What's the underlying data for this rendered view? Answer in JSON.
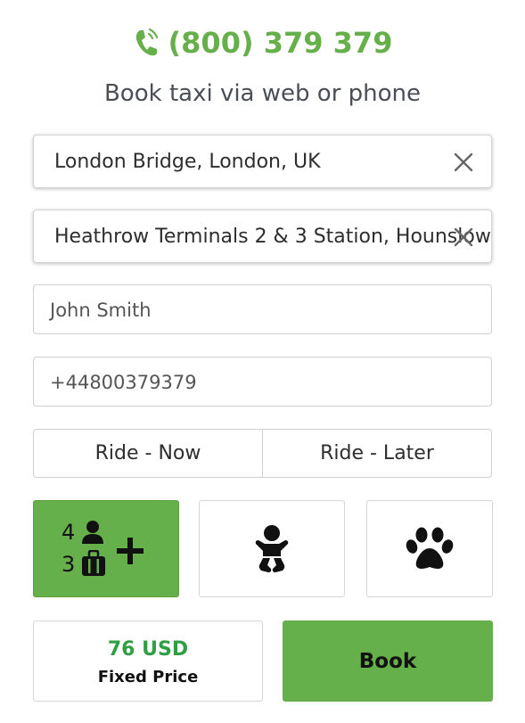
{
  "header": {
    "phone": "(800) 379 379",
    "subtitle": "Book taxi via web or phone",
    "accent_color": "#66b04b"
  },
  "form": {
    "pickup": {
      "value": "London Bridge, London, UK",
      "clear_icon": "close-icon"
    },
    "dropoff": {
      "value": "Heathrow Terminals 2 & 3 Station, Hounslow",
      "clear_icon": "close-icon"
    },
    "name": {
      "value": "John Smith"
    },
    "phone": {
      "value": "+44800379379"
    }
  },
  "ride_options": {
    "now": "Ride - Now",
    "later": "Ride - Later"
  },
  "extras": {
    "passengers": "4",
    "luggage": "3",
    "passenger_icon": "person-icon",
    "luggage_icon": "suitcase-icon",
    "add_icon": "plus-icon",
    "child_seat_icon": "baby-icon",
    "pet_icon": "paw-icon"
  },
  "footer": {
    "price": "76 USD",
    "price_label": "Fixed Price",
    "book_label": "Book"
  }
}
